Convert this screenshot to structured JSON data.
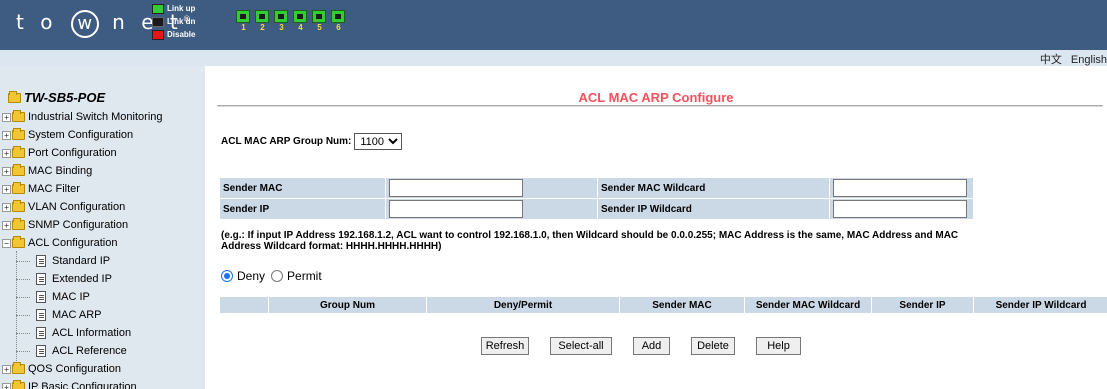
{
  "header": {
    "logo_parts": [
      "t o",
      "w",
      "n e t",
      "®"
    ],
    "legend": [
      "Link up",
      "Link dn",
      "Disable"
    ],
    "ports": [
      "1",
      "2",
      "3",
      "4",
      "5",
      "6"
    ]
  },
  "lang_bar": {
    "chinese": "中文",
    "english": "English"
  },
  "sidebar": {
    "root": "TW-SB5-POE",
    "items": [
      "Industrial Switch Monitoring",
      "System Configuration",
      "Port Configuration",
      "MAC Binding",
      "MAC Filter",
      "VLAN Configuration",
      "SNMP Configuration",
      "ACL Configuration"
    ],
    "acl_children": [
      "Standard IP",
      "Extended IP",
      "MAC IP",
      "MAC ARP",
      "ACL Information",
      "ACL Reference"
    ],
    "after": [
      "QOS Configuration",
      "IP Basic Configuration"
    ]
  },
  "main": {
    "title": "ACL MAC ARP Configure",
    "group_label": "ACL MAC ARP Group Num:",
    "group_value": "1100",
    "sender_mac_label": "Sender MAC",
    "sender_mac_value": "",
    "sender_mac_wildcard_label": "Sender MAC Wildcard",
    "sender_mac_wildcard_value": "",
    "sender_ip_label": "Sender IP",
    "sender_ip_value": "",
    "sender_ip_wildcard_label": "Sender IP Wildcard",
    "sender_ip_wildcard_value": "",
    "note": "(e.g.: If input IP Address 192.168.1.2, ACL want to control 192.168.1.0, then Wildcard should be 0.0.0.255; MAC Address is the same, MAC Address and MAC Address Wildcard format: HHHH.HHHH.HHHH)",
    "deny_label": "Deny",
    "permit_label": "Permit",
    "selected_action": "Deny",
    "columns": [
      "",
      "Group Num",
      "Deny/Permit",
      "Sender MAC",
      "Sender MAC Wildcard",
      "Sender IP",
      "Sender IP Wildcard"
    ],
    "buttons": {
      "refresh": "Refresh",
      "select_all": "Select-all",
      "add": "Add",
      "delete": "Delete",
      "help": "Help"
    }
  },
  "colors": {
    "header_bg": "#3e5c82",
    "sidebar_bg": "#dfe7ef",
    "title_color": "#f4515c",
    "table_header_bg": "#cbd8e6",
    "port_link_up": "#33cc33"
  }
}
